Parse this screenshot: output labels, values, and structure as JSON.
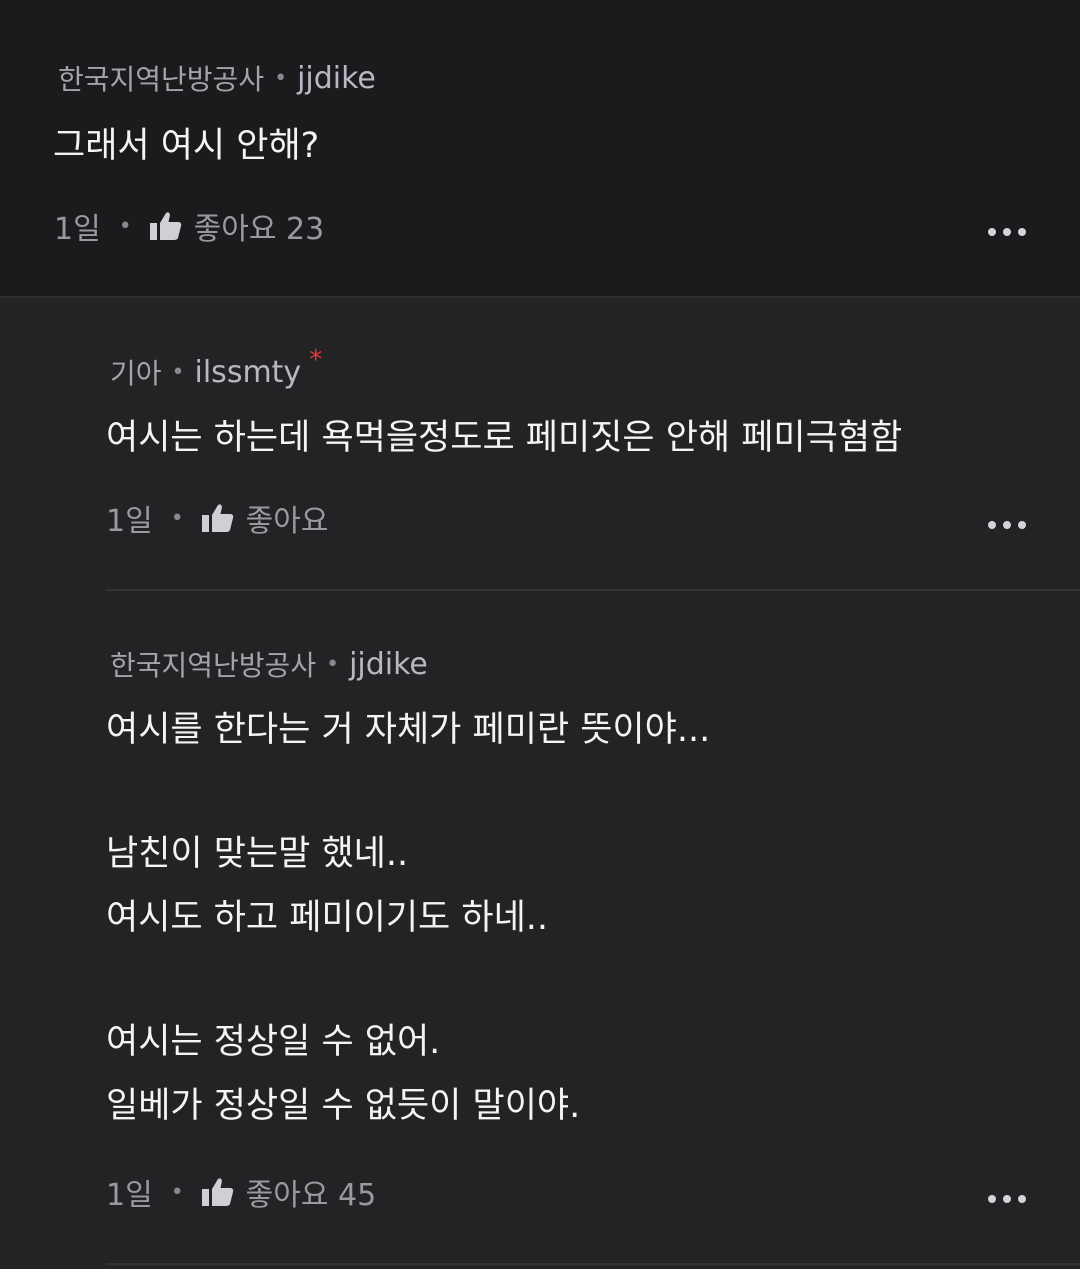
{
  "comments": [
    {
      "author_nick": "한국지역난방공사",
      "author_id": "jjdike",
      "text_lines": [
        "그래서 여시 안해?"
      ],
      "time": "1일",
      "like_label": "좋아요 23"
    },
    {
      "author_nick": "기아",
      "author_id": "ilssmty",
      "badge": "*",
      "text_lines": [
        "여시는 하는데 욕먹을정도로 페미짓은 안해 페미극혐함"
      ],
      "time": "1일",
      "like_label": "좋아요"
    },
    {
      "author_nick": "한국지역난방공사",
      "author_id": "jjdike",
      "text_lines": [
        "여시를 한다는 거 자체가 페미란 뜻이야...",
        "남친이 맞는말 했네..",
        "여시도 하고 페미이기도 하네..",
        "여시는 정상일 수 없어.",
        "일베가 정상일 수 없듯이 말이야."
      ],
      "time": "1일",
      "like_label": "좋아요 45"
    }
  ],
  "icons": {
    "like": "thumbs-up-icon",
    "more": "more-options-icon"
  },
  "colors": {
    "background_top": "#1b1b1d",
    "background_reply": "#232325",
    "badge": "#e03a3a"
  }
}
